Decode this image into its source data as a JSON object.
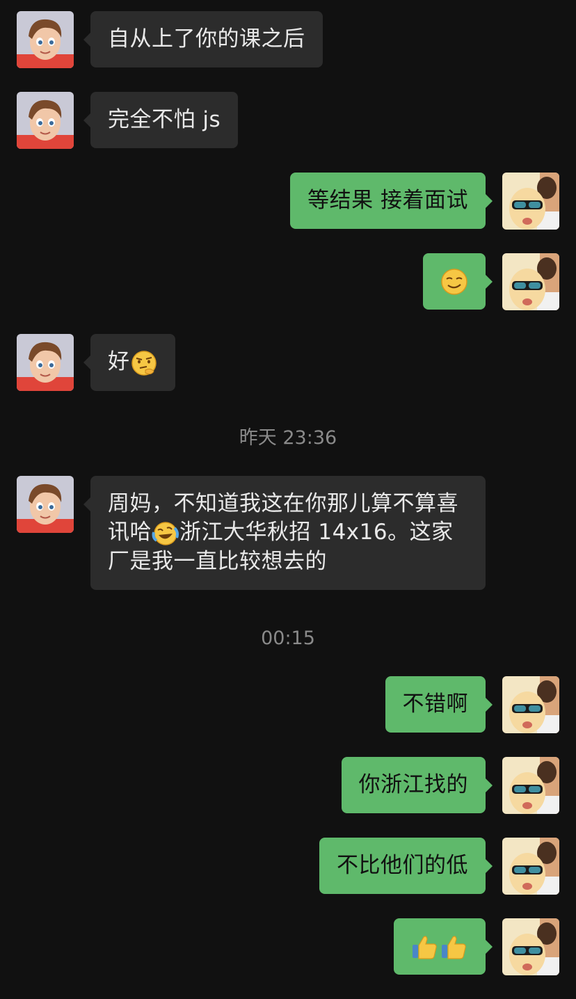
{
  "messages": [
    {
      "side": "in",
      "text": "自从上了你的课之后"
    },
    {
      "side": "in",
      "text": "完全不怕 js"
    },
    {
      "side": "out",
      "text": "等结果 接着面试"
    },
    {
      "side": "out",
      "emoji": "smirk-face-emoji"
    },
    {
      "side": "in",
      "text": "好",
      "emoji": "thinking-face-emoji"
    },
    {
      "side": "in",
      "text_before": "周妈，不知道我这在你那儿算不算喜讯哈",
      "emoji": "laughing-crying-emoji",
      "text_after": "浙江大华秋招 14x16。这家厂是我一直比较想去的"
    },
    {
      "side": "out",
      "text": "不错啊"
    },
    {
      "side": "out",
      "text": "你浙江找的"
    },
    {
      "side": "out",
      "text": "不比他们的低"
    },
    {
      "side": "out",
      "emoji": "thumbs-up-emoji",
      "count": 2
    }
  ],
  "timestamps": [
    "昨天 23:36",
    "00:15"
  ],
  "colors": {
    "background": "#111111",
    "incoming_bubble": "#2c2c2c",
    "outgoing_bubble": "#5fb96b",
    "incoming_text": "#e9e9e9",
    "outgoing_text": "#111111",
    "timestamp": "#8a8a8a"
  },
  "avatars": {
    "contact": "cartoon-boy-avatar",
    "self": "sunglasses-kid-avatar"
  }
}
